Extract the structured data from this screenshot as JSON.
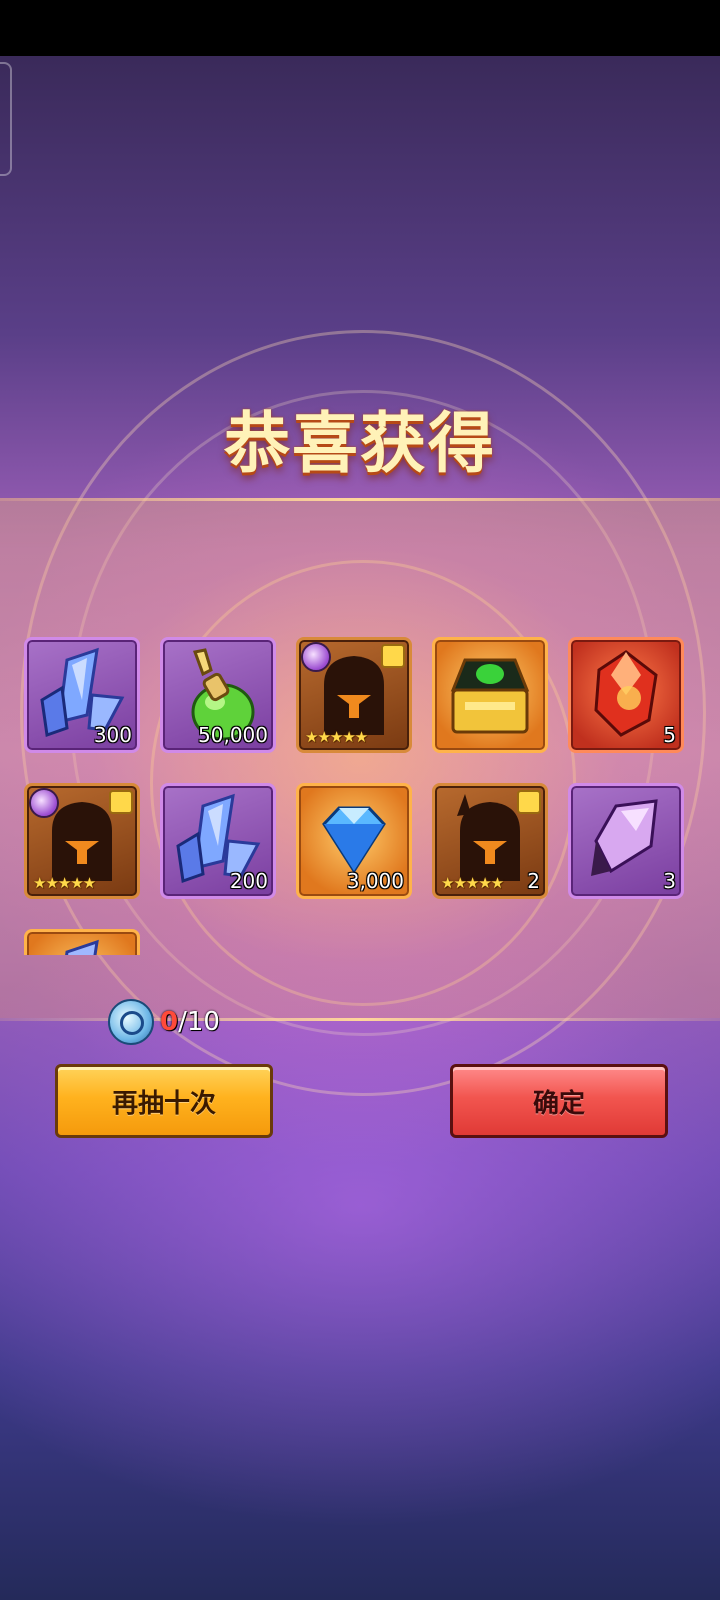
{
  "title": "恭喜获得",
  "rewards": [
    {
      "name": "blue-crystal",
      "frame": "purple",
      "qty": "300"
    },
    {
      "name": "green-potion",
      "frame": "purple",
      "qty": "50,000"
    },
    {
      "name": "hero-silhouette",
      "frame": "brown",
      "stars": "★★★★★",
      "badge": true,
      "puzzle": true
    },
    {
      "name": "golden-chest",
      "frame": "orange"
    },
    {
      "name": "red-gem",
      "frame": "red",
      "qty": "5"
    },
    {
      "name": "hero-silhouette",
      "frame": "brown",
      "stars": "★★★★★",
      "badge": true,
      "puzzle": true
    },
    {
      "name": "blue-crystal",
      "frame": "purple",
      "qty": "200"
    },
    {
      "name": "diamond",
      "frame": "orange",
      "qty": "3,000"
    },
    {
      "name": "hero-silhouette-horned",
      "frame": "brown",
      "stars": "★★★★★",
      "qty": "2",
      "puzzle": true
    },
    {
      "name": "purple-crystal",
      "frame": "purple",
      "qty": "3"
    },
    {
      "name": "partially-visible-item",
      "frame": "orange"
    }
  ],
  "cost": {
    "current": "0",
    "total": "/10",
    "icon": "summon-scroll-icon"
  },
  "buttons": {
    "retry_label": "再抽十次",
    "confirm_label": "确定"
  },
  "colors": {
    "purple_frame": "#d08ae8",
    "orange_frame": "#ffb34a",
    "red_frame": "#ff8a5a",
    "gold_button": "#ffb21e",
    "red_button": "#f2554f",
    "cost_current": "#ff4a3a"
  }
}
